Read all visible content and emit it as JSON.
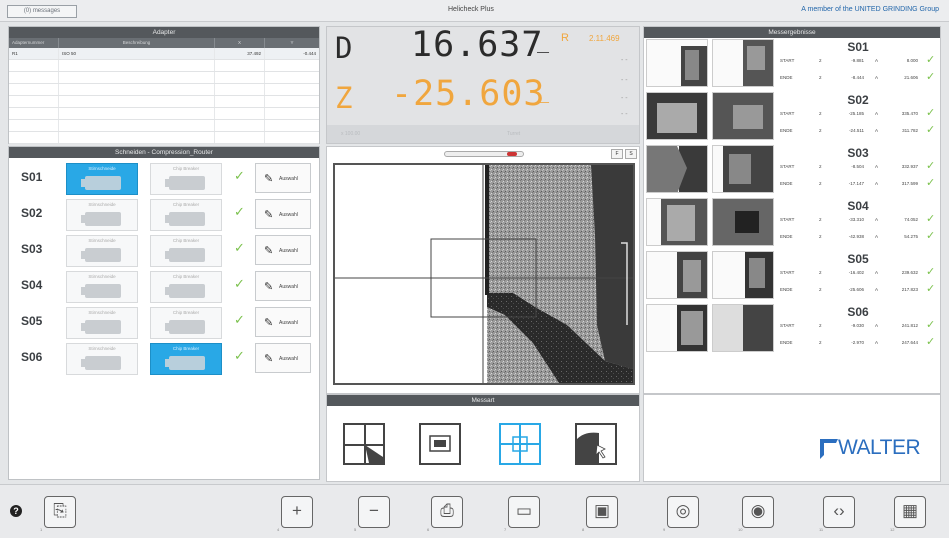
{
  "topbar": {
    "messages_label": "(0) messages",
    "title": "Helicheck Plus",
    "group_text": "A member of the UNITED GRINDING Group"
  },
  "adapter": {
    "title": "Adapter",
    "columns": [
      "Adapternummer",
      "Beschreibung",
      "X",
      "Y"
    ],
    "rows": [
      {
        "nr": "R1",
        "desc": "ISO 50",
        "x": "37.492",
        "y": "-0.444"
      }
    ]
  },
  "cutters": {
    "title": "Schneiden - Compression_Router",
    "left_tile_label": "Stirnschneide",
    "right_tile_label": "Chip Breaker",
    "auswahl_label": "Auswahl",
    "rows": [
      {
        "label": "S01",
        "left_active": true,
        "right_active": false
      },
      {
        "label": "S02",
        "left_active": false,
        "right_active": false
      },
      {
        "label": "S03",
        "left_active": false,
        "right_active": false
      },
      {
        "label": "S04",
        "left_active": false,
        "right_active": false
      },
      {
        "label": "S05",
        "left_active": false,
        "right_active": false
      },
      {
        "label": "S06",
        "left_active": false,
        "right_active": true
      }
    ]
  },
  "dro": {
    "d_label": "D",
    "d_value": "16.637",
    "d_unit": "_",
    "z_label": "Z",
    "z_value": "-25.603",
    "z_unit": "_",
    "r_label": "R",
    "r_value": "2.11.469",
    "dashes": "- -",
    "bottom_a": "x 100.00",
    "bottom_b": "Turret",
    "d_color": "#2b2b2b",
    "z_color": "#f0a63e"
  },
  "view": {
    "btn_f": "F",
    "btn_s": "S"
  },
  "messart": {
    "title": "Messart",
    "modes": [
      "mode-edge-icon",
      "mode-image-icon",
      "mode-crosshair-icon",
      "mode-profile-icon"
    ]
  },
  "results": {
    "title": "Messergebnisse",
    "blocks": [
      {
        "s": "S01",
        "rows": [
          {
            "k": "START",
            "n": "2",
            "v": "-9.881",
            "a": "A",
            "w": "8.000"
          },
          {
            "k": "ENDE",
            "n": "2",
            "v": "-8.444",
            "a": "A",
            "w": "21.606"
          }
        ]
      },
      {
        "s": "S02",
        "rows": [
          {
            "k": "START",
            "n": "2",
            "v": "-25.185",
            "a": "A",
            "w": "335.470"
          },
          {
            "k": "ENDE",
            "n": "2",
            "v": "-24.511",
            "a": "A",
            "w": "311.782"
          }
        ]
      },
      {
        "s": "S03",
        "rows": [
          {
            "k": "START",
            "n": "2",
            "v": "-8.504",
            "a": "A",
            "w": "332.937"
          },
          {
            "k": "ENDE",
            "n": "2",
            "v": "-17.147",
            "a": "A",
            "w": "317.599"
          }
        ]
      },
      {
        "s": "S04",
        "rows": [
          {
            "k": "START",
            "n": "2",
            "v": "-33.310",
            "a": "A",
            "w": "74.052"
          },
          {
            "k": "ENDE",
            "n": "2",
            "v": "-42.938",
            "a": "A",
            "w": "54.275"
          }
        ]
      },
      {
        "s": "S05",
        "rows": [
          {
            "k": "START",
            "n": "2",
            "v": "-16.402",
            "a": "A",
            "w": "239.632"
          },
          {
            "k": "ENDE",
            "n": "2",
            "v": "-25.606",
            "a": "A",
            "w": "217.823"
          }
        ]
      },
      {
        "s": "S06",
        "rows": [
          {
            "k": "START",
            "n": "2",
            "v": "-9.030",
            "a": "A",
            "w": "241.812"
          },
          {
            "k": "ENDE",
            "n": "2",
            "v": "-2.970",
            "a": "A",
            "w": "247.644"
          }
        ]
      }
    ]
  },
  "logo": {
    "text": "WALTER",
    "color": "#2b6ebf"
  },
  "toolbar": {
    "help": "?",
    "buttons": [
      {
        "name": "new-file-button",
        "glyph": "⎘",
        "num": "1"
      },
      {
        "name": "add-button",
        "glyph": "+",
        "num": "4"
      },
      {
        "name": "remove-button",
        "glyph": "−",
        "num": "5"
      },
      {
        "name": "print-button",
        "glyph": "⎙",
        "num": "6"
      },
      {
        "name": "measure-a-button",
        "glyph": "▭",
        "num": "7"
      },
      {
        "name": "measure-b-button",
        "glyph": "▣",
        "num": "8"
      },
      {
        "name": "xz-button",
        "glyph": "◎",
        "num": "9"
      },
      {
        "name": "center-button",
        "glyph": "◉",
        "num": "10"
      },
      {
        "name": "xml-button",
        "glyph": "‹›",
        "num": "11"
      },
      {
        "name": "settings-grid-button",
        "glyph": "▦",
        "num": "12"
      }
    ]
  }
}
